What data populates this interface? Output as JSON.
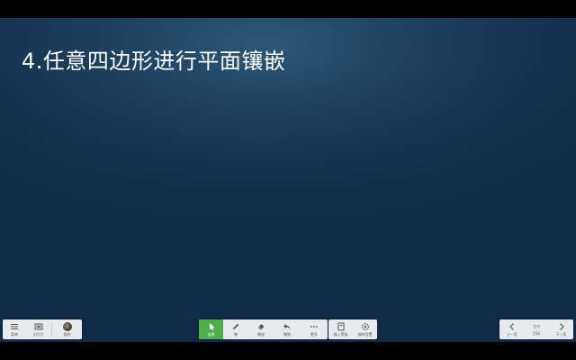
{
  "slide": {
    "title": "4.任意四边形进行平面镶嵌"
  },
  "toolbar": {
    "left": [
      {
        "icon": "menu-icon",
        "label": "菜单"
      },
      {
        "icon": "slides-icon",
        "label": "幻灯片"
      },
      {
        "icon": "avatar-icon",
        "label": "我的"
      }
    ],
    "center": [
      {
        "icon": "cursor-icon",
        "label": "选择"
      },
      {
        "icon": "pen-icon",
        "label": "笔"
      },
      {
        "icon": "eraser-icon",
        "label": "橡皮"
      },
      {
        "icon": "undo-icon",
        "label": "撤销"
      },
      {
        "icon": "more-icon",
        "label": "更多"
      }
    ],
    "center_extra": [
      {
        "icon": "blackboard-icon",
        "label": "插入黑板"
      },
      {
        "icon": "settings-icon",
        "label": "放映设置"
      }
    ],
    "nav": {
      "prev_label": "上一页",
      "page_indicator": "7/7",
      "page_label": "页码",
      "next_label": "下一页"
    }
  },
  "colors": {
    "slide_bg": "#1a3a5a",
    "toolbar_bg": "#e8ebee",
    "active_tool": "#4cae4c"
  }
}
